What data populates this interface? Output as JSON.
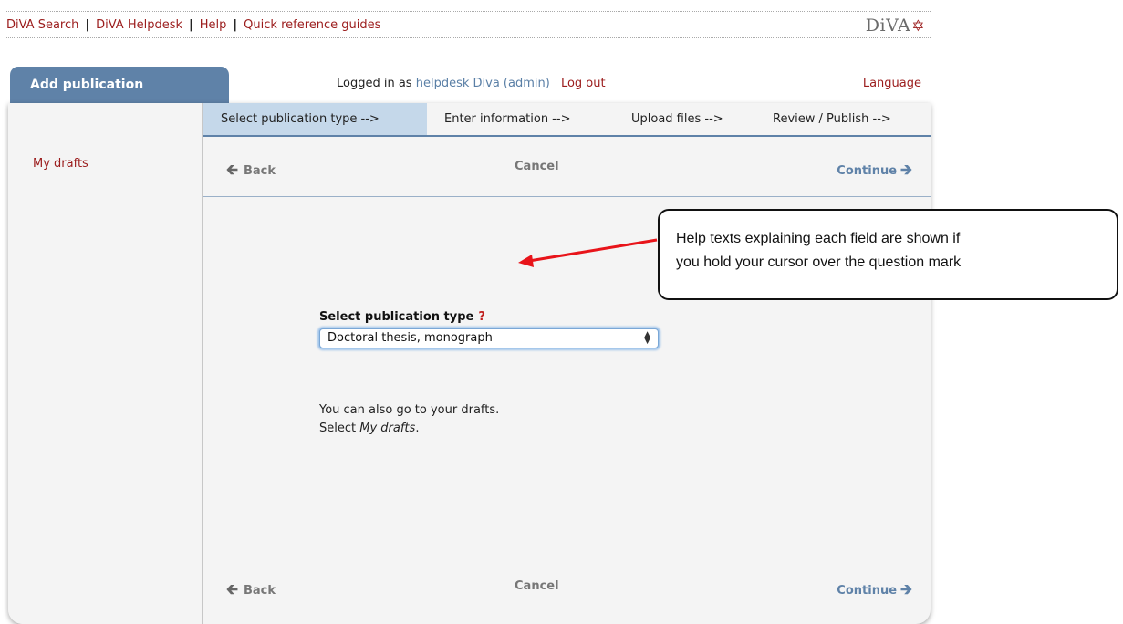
{
  "toplinks": {
    "search": "DiVA Search",
    "helpdesk": "DiVA Helpdesk",
    "help": "Help",
    "guides": "Quick reference guides",
    "separator": "|"
  },
  "logo": {
    "text": "DiVA",
    "star": "✡"
  },
  "tab": {
    "label": "Add publication"
  },
  "user": {
    "prefix": "Logged in as",
    "name": "helpdesk Diva (admin)",
    "logout": "Log out",
    "language": "Language"
  },
  "sidebar": {
    "my_drafts": "My drafts"
  },
  "steps": [
    {
      "label": "Select publication type -->",
      "active": true
    },
    {
      "label": "Enter information -->",
      "active": false
    },
    {
      "label": "Upload files -->",
      "active": false
    },
    {
      "label": "Review / Publish -->",
      "active": false
    }
  ],
  "nav": {
    "back": "Back",
    "cancel": "Cancel",
    "continue": "Continue"
  },
  "form": {
    "label": "Select publication type",
    "help_mark": "?",
    "selected_type": "Doctoral thesis, monograph"
  },
  "note": {
    "line1": "You can also go to your drafts.",
    "line2_prefix": "Select ",
    "line2_link": "My drafts",
    "line2_suffix": "."
  },
  "callout": {
    "line1": "Help texts explaining each field are shown if",
    "line2": "you hold your cursor over the question mark"
  },
  "colors": {
    "accent": "#5f82a8",
    "link_red": "#9b1c1c",
    "active_step": "#c5d8ea",
    "annotation_arrow": "#e8141a"
  },
  "icons": {
    "back": "arrow-left-icon",
    "continue": "arrow-right-icon",
    "select": "updown-chevron-icon"
  }
}
